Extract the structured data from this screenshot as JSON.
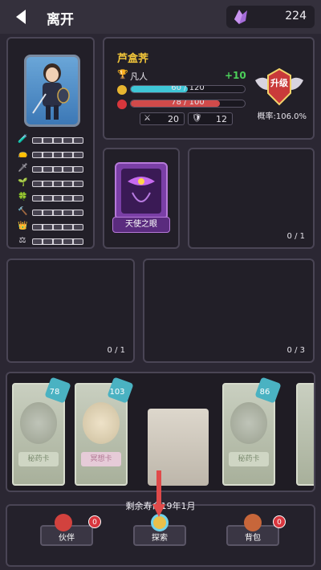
{
  "topbar": {
    "exit_label": "离开",
    "gem_count": "224"
  },
  "hero": {
    "name": "芦盒荠",
    "rank": "凡人",
    "exp_gain": "+10",
    "exp_text": "60 / 120",
    "exp_fraction": 0.5,
    "hp_text": "78 / 100",
    "hp_fraction": 0.78,
    "attack": "20",
    "defense": "12",
    "upgrade_label": "升级",
    "probability": "概率:106.0%"
  },
  "skill": {
    "label": "天使之眼"
  },
  "slots": {
    "slot1_count": "0 / 1",
    "slot2_count": "0 / 1",
    "slot3_count": "0 / 3"
  },
  "cards": [
    {
      "name": "秘药卡",
      "tag": "78",
      "style": "green"
    },
    {
      "name": "冥想卡",
      "tag": "103",
      "style": "pink"
    },
    {
      "name": "秘药卡",
      "tag": "86",
      "style": "green"
    }
  ],
  "lifespan": "剩余寿命19年1月",
  "nav": {
    "partner_label": "伙伴",
    "partner_badge": "0",
    "explore_label": "探索",
    "bag_label": "背包",
    "bag_badge": "0"
  }
}
